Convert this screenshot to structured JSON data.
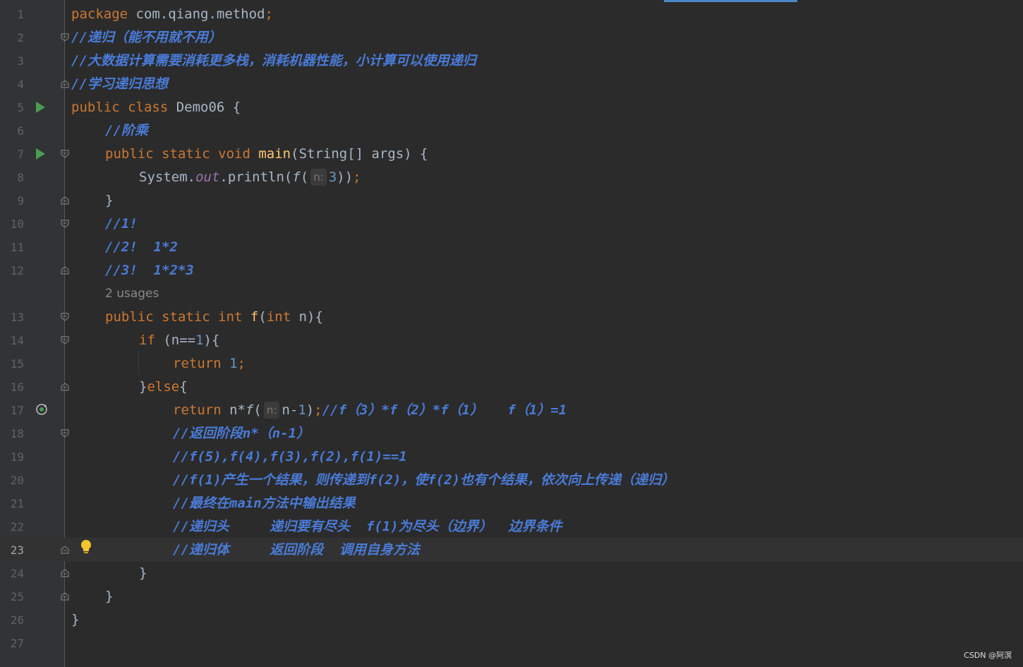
{
  "editor": {
    "line_numbers": [
      "1",
      "2",
      "3",
      "4",
      "5",
      "6",
      "7",
      "8",
      "9",
      "10",
      "11",
      "12",
      "13",
      "14",
      "15",
      "16",
      "17",
      "18",
      "19",
      "20",
      "21",
      "22",
      "23",
      "24",
      "25",
      "26",
      "27"
    ],
    "current_line": "23",
    "inlay_hint_label": "n:",
    "usages_hint": "2 usages",
    "code": {
      "l1_kw": "package",
      "l1_rest": " com.qiang.method",
      "l1_semi": ";",
      "l2": "//递归（能不用就不用）",
      "l3": "//大数据计算需要消耗更多栈，消耗机器性能，小计算可以使用递归",
      "l4": "//学习递归思想",
      "l5_kw": "public class",
      "l5_rest": " Demo06 {",
      "l6": "//阶乘",
      "l7_kw": "public static void",
      "l7_fn": "main",
      "l7_rest": "(String[] args) {",
      "l8_a": "System.",
      "l8_field": "out",
      "l8_b": ".println(",
      "l8_call": "f",
      "l8_c": "(",
      "l8_num": "3",
      "l8_d": "))",
      "l8_semi": ";",
      "l9": "}",
      "l10": "//1!",
      "l11": "//2!  1*2",
      "l12": "//3!  1*2*3",
      "l13_kw": "public static int",
      "l13_fn": "f",
      "l13_a": "(",
      "l13_kw2": "int",
      "l13_b": " n){",
      "l14_kw": "if",
      "l14_a": " (n==",
      "l14_num": "1",
      "l14_b": "){",
      "l15_kw": "return",
      "l15_num": "1",
      "l15_semi": ";",
      "l16_a": "}",
      "l16_kw": "else",
      "l16_b": "{",
      "l17_kw": "return",
      "l17_a": " n*",
      "l17_call": "f",
      "l17_b": "(",
      "l17_c": "n-",
      "l17_num": "1",
      "l17_d": ")",
      "l17_semi": ";",
      "l17_cm": "//f（3）*f（2）*f（1）   f（1）=1",
      "l18": "//返回阶段n*（n-1）",
      "l19": "//f(5),f(4),f(3),f(2),f(1)==1",
      "l20": "//f(1)产生一个结果，则传递到f(2)，使f(2)也有个结果，依次向上传递（递归）",
      "l21": "//最终在main方法中输出结果",
      "l22": "//递归头     递归要有尽头  f(1)为尽头（边界）  边界条件",
      "l23": "//递归体     返回阶段  调用自身方法",
      "l24": "}",
      "l25": "}",
      "l26": "}"
    }
  },
  "watermark": "CSDN @阿溟",
  "icons": {
    "run": "run-gutter-icon",
    "recursion": "recursive-call-icon",
    "bulb": "intention-bulb-icon",
    "fold": "fold-marker-icon"
  },
  "colors": {
    "background": "#2b2b2b",
    "gutter": "#313335",
    "keyword": "#cc7832",
    "function": "#ffc66d",
    "number": "#6897bb",
    "doc_comment": "#4a7bd8",
    "run_icon": "#499c54",
    "bulb": "#f4c42f"
  }
}
